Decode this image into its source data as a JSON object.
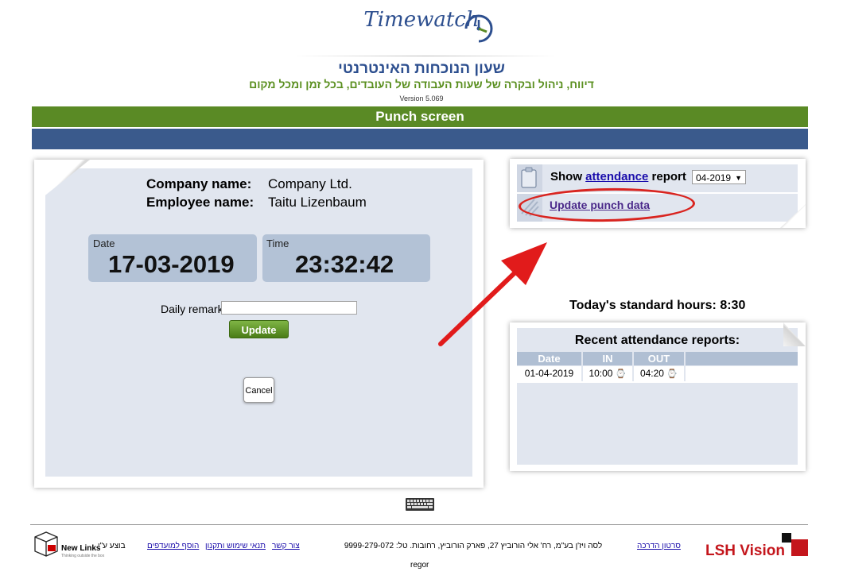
{
  "header": {
    "logo": "Timewatch",
    "title_he": "שעון הנוכחות האינטרנטי",
    "subtitle_he": "דיווח, ניהול ובקרה של שעות העבודה של העובדים, בכל זמן ומכל מקום",
    "version": "Version 5.069"
  },
  "page_title": "Punch screen",
  "punch": {
    "company_label": "Company name:",
    "company_value": "Company Ltd.",
    "employee_label": "Employee name:",
    "employee_value": "Taitu Lizenbaum",
    "date_label": "Date",
    "date_value": "17-03-2019",
    "time_label": "Time",
    "time_value": "23:32:42",
    "remark_label": "Daily remark",
    "remark_value": "",
    "update_label": "Update",
    "cancel_label": "Cancel"
  },
  "report": {
    "show_label": "Show",
    "attendance_link": "attendance",
    "report_label": "report",
    "month_selected": "04-2019",
    "update_punch_link": "Update punch data"
  },
  "standard_hours": "Today's standard hours: 8:30",
  "recent": {
    "title": "Recent attendance reports:",
    "headers": [
      "Date",
      "IN",
      "OUT"
    ],
    "rows": [
      {
        "date": "01-04-2019",
        "in": "10:00",
        "out": "04:20"
      }
    ]
  },
  "footer": {
    "executed_by": "בוצע ע\"י",
    "newlinks": "New Links",
    "newlinks_tag": "Thinking outside the box",
    "add_favorites": "הוסף למועדפים",
    "terms": "תנאי שימוש ותקנון",
    "contact": "צור קשר",
    "address": "לסה ויז'ן בע\"מ, רח' אלי הורוביץ 27, פארק הורוביץ, רחובות. טל: 9999-279-072",
    "user": "regor",
    "tutorial": "סרטון הדרכה",
    "lsh_logo": "LSH Vision"
  },
  "colors": {
    "green_bar": "#5a8a25",
    "blue_bar": "#3a5a8c",
    "panel_bg": "#e1e6ef",
    "datetime_box": "#b3c2d6",
    "annotation_red": "#d9241f"
  },
  "icons": {
    "clipboard": "clipboard-icon",
    "stripes": "stripes-icon",
    "clock": "clock-icon",
    "keyboard": "keyboard-icon"
  }
}
